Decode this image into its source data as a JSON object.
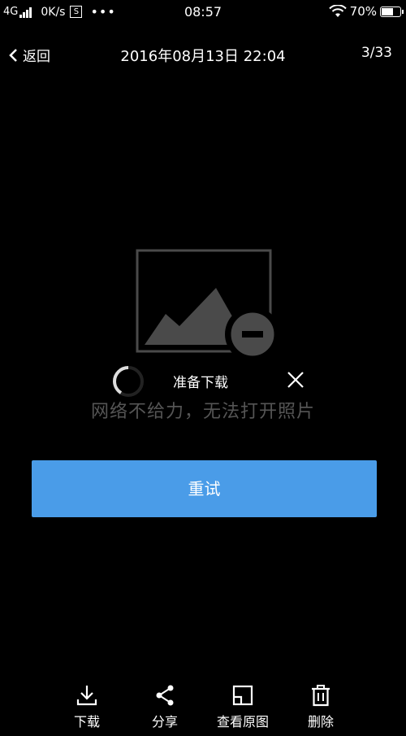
{
  "status_bar": {
    "network": "4G",
    "speed": "0K/s",
    "sim_icon_label": "S",
    "more": "•••",
    "time": "08:57",
    "battery_percent": "70%",
    "battery_level": 0.7
  },
  "nav": {
    "back_label": "返回",
    "title": "2016年08月13日 22:04",
    "counter": "3/33"
  },
  "loading": {
    "text": "准备下载"
  },
  "error": {
    "message": "网络不给力，无法打开照片"
  },
  "retry": {
    "label": "重试"
  },
  "toolbar": {
    "items": [
      {
        "label": "下载",
        "icon": "download-icon"
      },
      {
        "label": "分享",
        "icon": "share-icon"
      },
      {
        "label": "查看原图",
        "icon": "original-image-icon"
      },
      {
        "label": "删除",
        "icon": "trash-icon"
      }
    ]
  }
}
